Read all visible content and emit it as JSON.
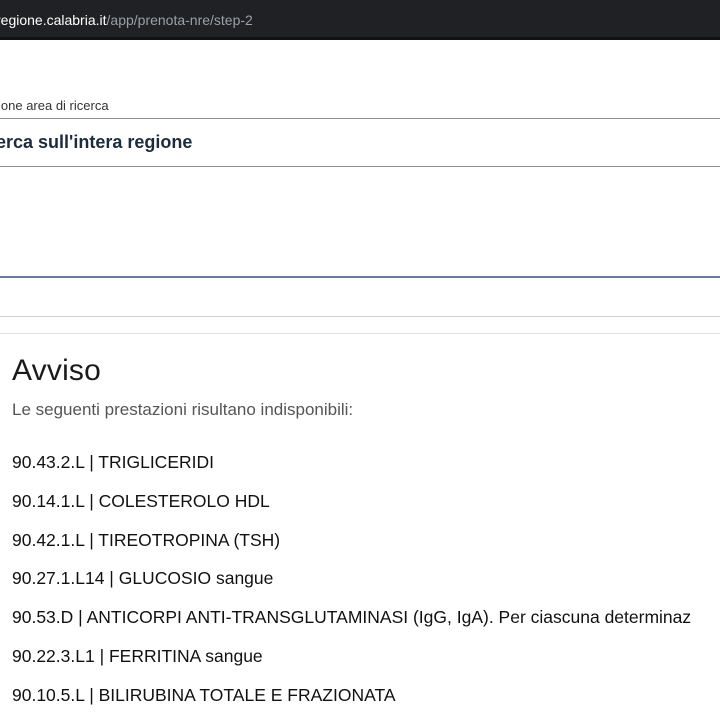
{
  "browser": {
    "url_host": "regione.calabria.it",
    "url_path": "/app/prenota-nre/step-2"
  },
  "search_area": {
    "label": "ione area di ricerca",
    "value": "erca sull'intera regione"
  },
  "notice": {
    "title": "Avviso",
    "subtitle": "Le seguenti prestazioni risultano indisponibili:",
    "items": [
      "90.43.2.L | TRIGLICERIDI",
      "90.14.1.L | COLESTEROLO HDL",
      "90.42.1.L | TIREOTROPINA (TSH)",
      "90.27.1.L14 | GLUCOSIO sangue",
      "90.53.D | ANTICORPI ANTI-TRANSGLUTAMINASI (IgG, IgA). Per ciascuna determinaz",
      "90.22.3.L1 | FERRITINA sangue",
      "90.10.5.L | BILIRUBINA TOTALE E FRAZIONATA"
    ]
  }
}
